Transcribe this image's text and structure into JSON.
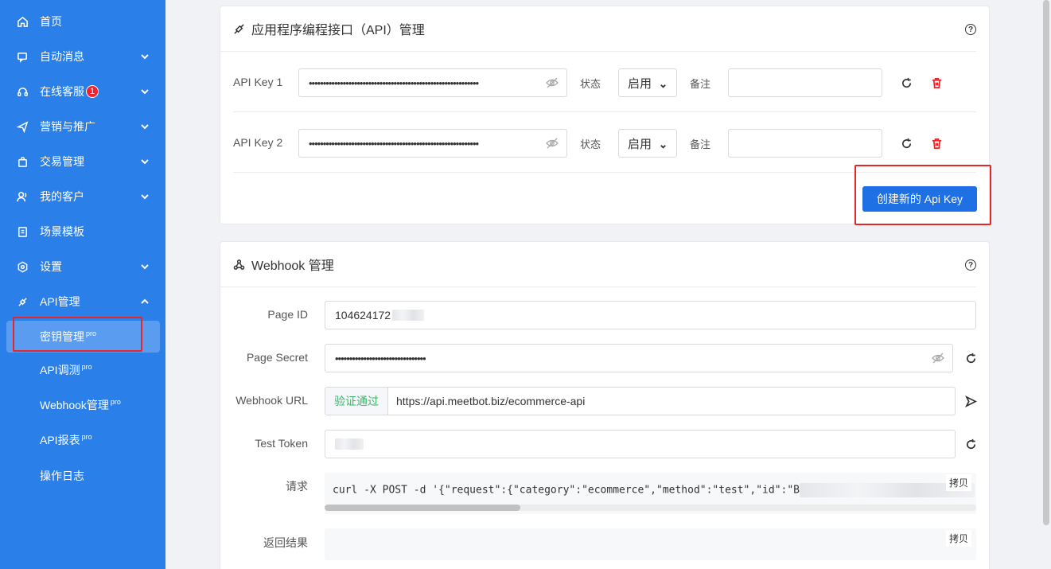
{
  "sidebar": {
    "items": [
      {
        "label": "首页",
        "icon": "home-icon"
      },
      {
        "label": "自动消息",
        "icon": "message-icon"
      },
      {
        "label": "在线客服",
        "icon": "headset-icon",
        "badge": "1"
      },
      {
        "label": "营销与推广",
        "icon": "send-icon"
      },
      {
        "label": "交易管理",
        "icon": "bag-icon"
      },
      {
        "label": "我的客户",
        "icon": "users-icon"
      },
      {
        "label": "场景模板",
        "icon": "template-icon"
      },
      {
        "label": "设置",
        "icon": "settings-icon"
      },
      {
        "label": "API管理",
        "icon": "api-icon"
      }
    ],
    "sub_items": [
      {
        "label": "密钥管理",
        "tag": "pro"
      },
      {
        "label": "API调测",
        "tag": "pro"
      },
      {
        "label": "Webhook管理",
        "tag": "pro"
      },
      {
        "label": "API报表",
        "tag": "pro"
      },
      {
        "label": "操作日志",
        "tag": ""
      }
    ]
  },
  "api_card": {
    "title": "应用程序编程接口（API）管理",
    "keys": [
      {
        "label": "API Key 1",
        "masked": "••••••••••••••••••••••••••••••••••••••••••••••••••••••••••••",
        "status_label": "状态",
        "status": "启用",
        "note_label": "备注",
        "note": ""
      },
      {
        "label": "API Key 2",
        "masked": "••••••••••••••••••••••••••••••••••••••••••••••••••••••••••••",
        "status_label": "状态",
        "status": "启用",
        "note_label": "备注",
        "note": ""
      }
    ],
    "create_button": "创建新的 Api Key"
  },
  "webhook_card": {
    "title": "Webhook 管理",
    "page_id_label": "Page ID",
    "page_id": "104624172",
    "page_secret_label": "Page Secret",
    "page_secret": "••••••••••••••••••••••••••••••••",
    "webhook_url_label": "Webhook URL",
    "verified": "验证通过",
    "webhook_url": "https://api.meetbot.biz/ecommerce-api",
    "test_token_label": "Test Token",
    "request_label": "请求",
    "request": "curl -X POST  -d '{\"request\":{\"category\":\"ecommerce\",\"method\":\"test\",\"id\":\"B",
    "copy": "拷贝",
    "result_label": "返回结果",
    "result_copy": "拷贝"
  },
  "colors": {
    "sidebar": "#2b7fe8",
    "primary": "#1f6fe5",
    "danger": "#e5262a",
    "success": "#3bb566"
  }
}
